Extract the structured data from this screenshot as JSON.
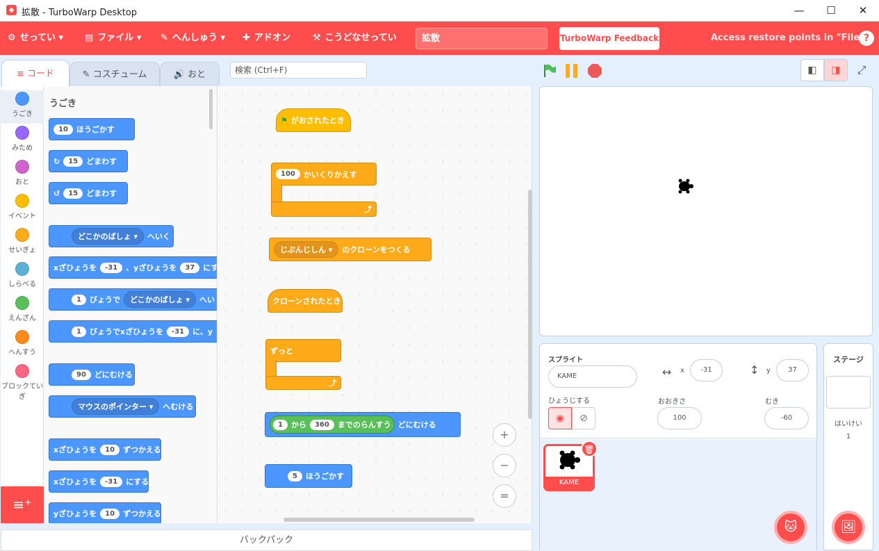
{
  "window": {
    "title": "拡散 - TurboWarp Desktop",
    "app_icon": "turbowarp-icon",
    "minimize": "—",
    "maximize": "☐",
    "close": "✕"
  },
  "menu": {
    "settings": "せってい",
    "file": "ファイル",
    "edit": "へんしゅう",
    "addons": "アドオン",
    "howto": "こうどなせってい",
    "project_title": "拡散",
    "feedback": "TurboWarp Feedback",
    "restore": "Access restore points in \"File\"",
    "help": "?"
  },
  "tabs": {
    "code": "コード",
    "costumes": "コスチューム",
    "sounds": "おと"
  },
  "search": {
    "placeholder": "検索 (Ctrl+F)"
  },
  "categories": [
    {
      "label": "うごき",
      "color": "#4c97ff"
    },
    {
      "label": "みため",
      "color": "#9966ff"
    },
    {
      "label": "おと",
      "color": "#cf63cf"
    },
    {
      "label": "イベント",
      "color": "#ffbf00"
    },
    {
      "label": "せいぎょ",
      "color": "#ffab19"
    },
    {
      "label": "しらべる",
      "color": "#5cb1d6"
    },
    {
      "label": "えんざん",
      "color": "#59c059"
    },
    {
      "label": "へんすう",
      "color": "#ff8c1a"
    },
    {
      "label": "ブロックていぎ",
      "color": "#ff6680"
    }
  ],
  "palette": {
    "heading": "うごき",
    "move": {
      "num": "10",
      "text": "ほうごかす"
    },
    "turn_right": {
      "num": "15",
      "text": "どまわす"
    },
    "turn_left": {
      "num": "15",
      "text": "どまわす"
    },
    "goto": {
      "drop": "どこかのばしょ",
      "text": "へいく"
    },
    "gotoxy": {
      "t1": "xざひょうを",
      "n1": "-31",
      "t2": "、yざひょうを",
      "n2": "37",
      "t3": "にする"
    },
    "glide": {
      "num": "1",
      "t1": "びょうで",
      "drop": "どこかのばしょ",
      "t2": "へい"
    },
    "glidexy": {
      "num": "1",
      "t1": "びょうでxざひょうを",
      "n2": "-31",
      "t2": "に、y"
    },
    "point": {
      "num": "90",
      "text": "どにむける"
    },
    "pointto": {
      "drop": "マウスのポインター",
      "text": "へむける"
    },
    "changex": {
      "t1": "xざひょうを",
      "num": "10",
      "t2": "ずつかえる"
    },
    "setx": {
      "t1": "xざひょうを",
      "num": "-31",
      "t2": "にする"
    },
    "changey": {
      "t1": "yざひょうを",
      "num": "10",
      "t2": "ずつかえる"
    }
  },
  "script": {
    "flag_hat": "がおされたとき",
    "repeat": {
      "num": "100",
      "text": "かいくりかえす"
    },
    "clone": {
      "drop": "じぶんじしん",
      "text": "のクローンをつくる"
    },
    "clone_hat": "クローンされたとき",
    "forever": "ずっと",
    "point_random": {
      "t0": "1",
      "t1": "から",
      "n2": "360",
      "t2": "までのらんすう",
      "t3": "どにむける"
    },
    "move": {
      "num": "5",
      "text": "ほうごかす"
    }
  },
  "zoom": {
    "in": "+",
    "out": "−",
    "reset": "="
  },
  "backpack": "バックパック",
  "sprite": {
    "label": "スプライト",
    "name": "KAME",
    "x_label": "x",
    "x": "-31",
    "y_label": "y",
    "y": "37",
    "show_label": "ひょうじする",
    "size_label": "おおきさ",
    "size": "100",
    "direction_label": "むき",
    "direction": "-60"
  },
  "sprite_thumb": {
    "name": "KAME"
  },
  "stage_panel": {
    "title": "ステージ",
    "backdrops_label": "はいけい",
    "backdrops_count": "1"
  },
  "colors": {
    "accent": "#ff4c4c",
    "motion": "#4c97ff",
    "control": "#ffab19",
    "events": "#ffbf00",
    "operators": "#59c059"
  }
}
